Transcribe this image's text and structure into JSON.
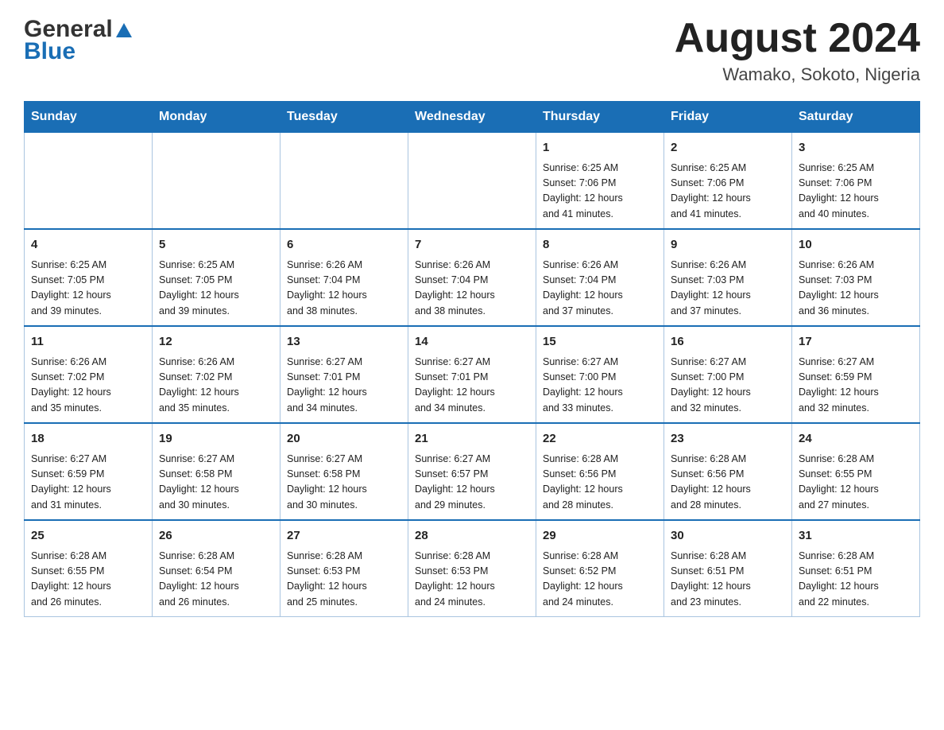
{
  "header": {
    "logo_text1": "General",
    "logo_text2": "Blue",
    "month_title": "August 2024",
    "location": "Wamako, Sokoto, Nigeria"
  },
  "weekdays": [
    "Sunday",
    "Monday",
    "Tuesday",
    "Wednesday",
    "Thursday",
    "Friday",
    "Saturday"
  ],
  "weeks": [
    [
      {
        "day": "",
        "info": ""
      },
      {
        "day": "",
        "info": ""
      },
      {
        "day": "",
        "info": ""
      },
      {
        "day": "",
        "info": ""
      },
      {
        "day": "1",
        "info": "Sunrise: 6:25 AM\nSunset: 7:06 PM\nDaylight: 12 hours\nand 41 minutes."
      },
      {
        "day": "2",
        "info": "Sunrise: 6:25 AM\nSunset: 7:06 PM\nDaylight: 12 hours\nand 41 minutes."
      },
      {
        "day": "3",
        "info": "Sunrise: 6:25 AM\nSunset: 7:06 PM\nDaylight: 12 hours\nand 40 minutes."
      }
    ],
    [
      {
        "day": "4",
        "info": "Sunrise: 6:25 AM\nSunset: 7:05 PM\nDaylight: 12 hours\nand 39 minutes."
      },
      {
        "day": "5",
        "info": "Sunrise: 6:25 AM\nSunset: 7:05 PM\nDaylight: 12 hours\nand 39 minutes."
      },
      {
        "day": "6",
        "info": "Sunrise: 6:26 AM\nSunset: 7:04 PM\nDaylight: 12 hours\nand 38 minutes."
      },
      {
        "day": "7",
        "info": "Sunrise: 6:26 AM\nSunset: 7:04 PM\nDaylight: 12 hours\nand 38 minutes."
      },
      {
        "day": "8",
        "info": "Sunrise: 6:26 AM\nSunset: 7:04 PM\nDaylight: 12 hours\nand 37 minutes."
      },
      {
        "day": "9",
        "info": "Sunrise: 6:26 AM\nSunset: 7:03 PM\nDaylight: 12 hours\nand 37 minutes."
      },
      {
        "day": "10",
        "info": "Sunrise: 6:26 AM\nSunset: 7:03 PM\nDaylight: 12 hours\nand 36 minutes."
      }
    ],
    [
      {
        "day": "11",
        "info": "Sunrise: 6:26 AM\nSunset: 7:02 PM\nDaylight: 12 hours\nand 35 minutes."
      },
      {
        "day": "12",
        "info": "Sunrise: 6:26 AM\nSunset: 7:02 PM\nDaylight: 12 hours\nand 35 minutes."
      },
      {
        "day": "13",
        "info": "Sunrise: 6:27 AM\nSunset: 7:01 PM\nDaylight: 12 hours\nand 34 minutes."
      },
      {
        "day": "14",
        "info": "Sunrise: 6:27 AM\nSunset: 7:01 PM\nDaylight: 12 hours\nand 34 minutes."
      },
      {
        "day": "15",
        "info": "Sunrise: 6:27 AM\nSunset: 7:00 PM\nDaylight: 12 hours\nand 33 minutes."
      },
      {
        "day": "16",
        "info": "Sunrise: 6:27 AM\nSunset: 7:00 PM\nDaylight: 12 hours\nand 32 minutes."
      },
      {
        "day": "17",
        "info": "Sunrise: 6:27 AM\nSunset: 6:59 PM\nDaylight: 12 hours\nand 32 minutes."
      }
    ],
    [
      {
        "day": "18",
        "info": "Sunrise: 6:27 AM\nSunset: 6:59 PM\nDaylight: 12 hours\nand 31 minutes."
      },
      {
        "day": "19",
        "info": "Sunrise: 6:27 AM\nSunset: 6:58 PM\nDaylight: 12 hours\nand 30 minutes."
      },
      {
        "day": "20",
        "info": "Sunrise: 6:27 AM\nSunset: 6:58 PM\nDaylight: 12 hours\nand 30 minutes."
      },
      {
        "day": "21",
        "info": "Sunrise: 6:27 AM\nSunset: 6:57 PM\nDaylight: 12 hours\nand 29 minutes."
      },
      {
        "day": "22",
        "info": "Sunrise: 6:28 AM\nSunset: 6:56 PM\nDaylight: 12 hours\nand 28 minutes."
      },
      {
        "day": "23",
        "info": "Sunrise: 6:28 AM\nSunset: 6:56 PM\nDaylight: 12 hours\nand 28 minutes."
      },
      {
        "day": "24",
        "info": "Sunrise: 6:28 AM\nSunset: 6:55 PM\nDaylight: 12 hours\nand 27 minutes."
      }
    ],
    [
      {
        "day": "25",
        "info": "Sunrise: 6:28 AM\nSunset: 6:55 PM\nDaylight: 12 hours\nand 26 minutes."
      },
      {
        "day": "26",
        "info": "Sunrise: 6:28 AM\nSunset: 6:54 PM\nDaylight: 12 hours\nand 26 minutes."
      },
      {
        "day": "27",
        "info": "Sunrise: 6:28 AM\nSunset: 6:53 PM\nDaylight: 12 hours\nand 25 minutes."
      },
      {
        "day": "28",
        "info": "Sunrise: 6:28 AM\nSunset: 6:53 PM\nDaylight: 12 hours\nand 24 minutes."
      },
      {
        "day": "29",
        "info": "Sunrise: 6:28 AM\nSunset: 6:52 PM\nDaylight: 12 hours\nand 24 minutes."
      },
      {
        "day": "30",
        "info": "Sunrise: 6:28 AM\nSunset: 6:51 PM\nDaylight: 12 hours\nand 23 minutes."
      },
      {
        "day": "31",
        "info": "Sunrise: 6:28 AM\nSunset: 6:51 PM\nDaylight: 12 hours\nand 22 minutes."
      }
    ]
  ]
}
